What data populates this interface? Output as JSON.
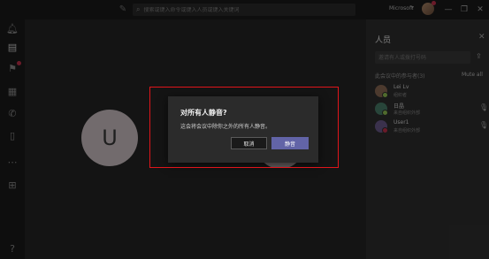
{
  "titlebar": {
    "search_placeholder": "搜索或键入命令或键入人员或键入关键词",
    "tenant": "Microsoft"
  },
  "stage": {
    "avatar_initial": "U"
  },
  "people_panel": {
    "title": "人员",
    "search_placeholder": "邀请有人或拨打号码",
    "section_header": "此会议中的参与者(3)",
    "mute_all": "Mute all",
    "participants": [
      {
        "name": "Lei Lv",
        "subtitle": "组织者",
        "status_color": "#92c353",
        "avatar_color": "#8a6a55"
      },
      {
        "name": "日晶",
        "subtitle": "来自组织外部",
        "status_color": "#92c353",
        "avatar_color": "#4a7f6a"
      },
      {
        "name": "User1",
        "subtitle": "来自组织外部",
        "status_color": "#c4314b",
        "avatar_color": "#6a5a8a"
      }
    ]
  },
  "dialog": {
    "title": "对所有人静音?",
    "body": "这会将会议中除你之外的所有人静音。",
    "cancel_label": "取消",
    "confirm_label": "静音"
  },
  "colors": {
    "accent": "#6264a7",
    "highlight": "#e0151b"
  }
}
